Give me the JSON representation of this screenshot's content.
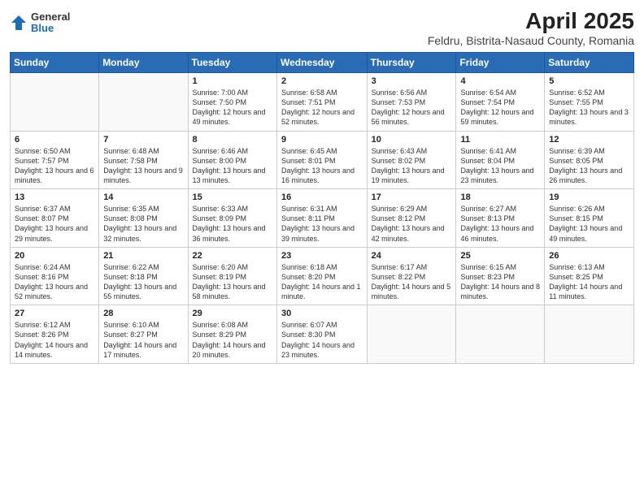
{
  "header": {
    "logo_general": "General",
    "logo_blue": "Blue",
    "title": "April 2025",
    "subtitle": "Feldru, Bistrita-Nasaud County, Romania"
  },
  "calendar": {
    "days_of_week": [
      "Sunday",
      "Monday",
      "Tuesday",
      "Wednesday",
      "Thursday",
      "Friday",
      "Saturday"
    ],
    "weeks": [
      [
        {
          "day": "",
          "info": ""
        },
        {
          "day": "",
          "info": ""
        },
        {
          "day": "1",
          "info": "Sunrise: 7:00 AM\nSunset: 7:50 PM\nDaylight: 12 hours and 49 minutes."
        },
        {
          "day": "2",
          "info": "Sunrise: 6:58 AM\nSunset: 7:51 PM\nDaylight: 12 hours and 52 minutes."
        },
        {
          "day": "3",
          "info": "Sunrise: 6:56 AM\nSunset: 7:53 PM\nDaylight: 12 hours and 56 minutes."
        },
        {
          "day": "4",
          "info": "Sunrise: 6:54 AM\nSunset: 7:54 PM\nDaylight: 12 hours and 59 minutes."
        },
        {
          "day": "5",
          "info": "Sunrise: 6:52 AM\nSunset: 7:55 PM\nDaylight: 13 hours and 3 minutes."
        }
      ],
      [
        {
          "day": "6",
          "info": "Sunrise: 6:50 AM\nSunset: 7:57 PM\nDaylight: 13 hours and 6 minutes."
        },
        {
          "day": "7",
          "info": "Sunrise: 6:48 AM\nSunset: 7:58 PM\nDaylight: 13 hours and 9 minutes."
        },
        {
          "day": "8",
          "info": "Sunrise: 6:46 AM\nSunset: 8:00 PM\nDaylight: 13 hours and 13 minutes."
        },
        {
          "day": "9",
          "info": "Sunrise: 6:45 AM\nSunset: 8:01 PM\nDaylight: 13 hours and 16 minutes."
        },
        {
          "day": "10",
          "info": "Sunrise: 6:43 AM\nSunset: 8:02 PM\nDaylight: 13 hours and 19 minutes."
        },
        {
          "day": "11",
          "info": "Sunrise: 6:41 AM\nSunset: 8:04 PM\nDaylight: 13 hours and 23 minutes."
        },
        {
          "day": "12",
          "info": "Sunrise: 6:39 AM\nSunset: 8:05 PM\nDaylight: 13 hours and 26 minutes."
        }
      ],
      [
        {
          "day": "13",
          "info": "Sunrise: 6:37 AM\nSunset: 8:07 PM\nDaylight: 13 hours and 29 minutes."
        },
        {
          "day": "14",
          "info": "Sunrise: 6:35 AM\nSunset: 8:08 PM\nDaylight: 13 hours and 32 minutes."
        },
        {
          "day": "15",
          "info": "Sunrise: 6:33 AM\nSunset: 8:09 PM\nDaylight: 13 hours and 36 minutes."
        },
        {
          "day": "16",
          "info": "Sunrise: 6:31 AM\nSunset: 8:11 PM\nDaylight: 13 hours and 39 minutes."
        },
        {
          "day": "17",
          "info": "Sunrise: 6:29 AM\nSunset: 8:12 PM\nDaylight: 13 hours and 42 minutes."
        },
        {
          "day": "18",
          "info": "Sunrise: 6:27 AM\nSunset: 8:13 PM\nDaylight: 13 hours and 46 minutes."
        },
        {
          "day": "19",
          "info": "Sunrise: 6:26 AM\nSunset: 8:15 PM\nDaylight: 13 hours and 49 minutes."
        }
      ],
      [
        {
          "day": "20",
          "info": "Sunrise: 6:24 AM\nSunset: 8:16 PM\nDaylight: 13 hours and 52 minutes."
        },
        {
          "day": "21",
          "info": "Sunrise: 6:22 AM\nSunset: 8:18 PM\nDaylight: 13 hours and 55 minutes."
        },
        {
          "day": "22",
          "info": "Sunrise: 6:20 AM\nSunset: 8:19 PM\nDaylight: 13 hours and 58 minutes."
        },
        {
          "day": "23",
          "info": "Sunrise: 6:18 AM\nSunset: 8:20 PM\nDaylight: 14 hours and 1 minute."
        },
        {
          "day": "24",
          "info": "Sunrise: 6:17 AM\nSunset: 8:22 PM\nDaylight: 14 hours and 5 minutes."
        },
        {
          "day": "25",
          "info": "Sunrise: 6:15 AM\nSunset: 8:23 PM\nDaylight: 14 hours and 8 minutes."
        },
        {
          "day": "26",
          "info": "Sunrise: 6:13 AM\nSunset: 8:25 PM\nDaylight: 14 hours and 11 minutes."
        }
      ],
      [
        {
          "day": "27",
          "info": "Sunrise: 6:12 AM\nSunset: 8:26 PM\nDaylight: 14 hours and 14 minutes."
        },
        {
          "day": "28",
          "info": "Sunrise: 6:10 AM\nSunset: 8:27 PM\nDaylight: 14 hours and 17 minutes."
        },
        {
          "day": "29",
          "info": "Sunrise: 6:08 AM\nSunset: 8:29 PM\nDaylight: 14 hours and 20 minutes."
        },
        {
          "day": "30",
          "info": "Sunrise: 6:07 AM\nSunset: 8:30 PM\nDaylight: 14 hours and 23 minutes."
        },
        {
          "day": "",
          "info": ""
        },
        {
          "day": "",
          "info": ""
        },
        {
          "day": "",
          "info": ""
        }
      ]
    ]
  }
}
